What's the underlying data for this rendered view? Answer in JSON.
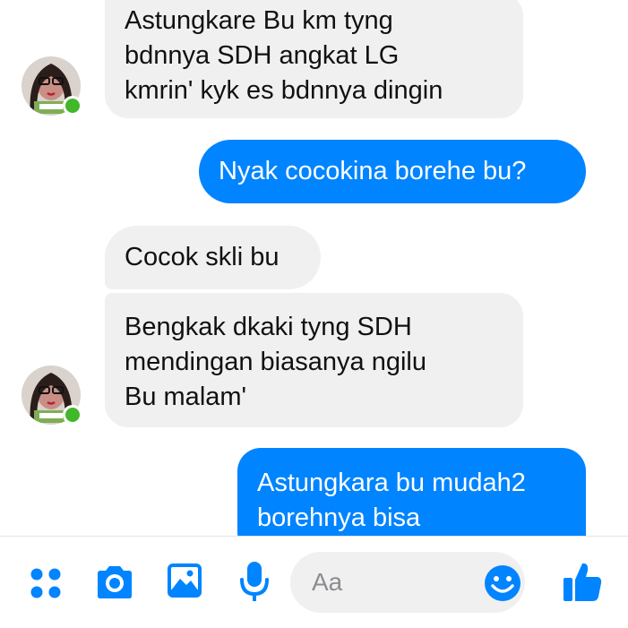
{
  "conversation": {
    "messages": [
      {
        "direction": "incoming",
        "text": "Astungkare Bu km tyng\nbdnnya SDH angkat LG\nkmrin' kyk es bdnnya dingin"
      },
      {
        "direction": "outgoing",
        "text": "Nyak cocokina borehe bu?"
      },
      {
        "direction": "incoming",
        "text": "Cocok skli bu"
      },
      {
        "direction": "incoming",
        "text": "Bengkak dkaki tyng SDH\nmendingan biasanya ngilu\nBu malam'"
      },
      {
        "direction": "outgoing",
        "text": "Astungkara bu mudah2\nborehnya bisa"
      }
    ]
  },
  "composer": {
    "placeholder": "Aa",
    "icons": [
      "apps-icon",
      "camera-icon",
      "image-icon",
      "microphone-icon",
      "emoji-icon",
      "thumbs-up-icon"
    ]
  },
  "colors": {
    "accent": "#0084ff",
    "incoming_bubble": "#f1f0f0",
    "online": "#42b72a"
  }
}
